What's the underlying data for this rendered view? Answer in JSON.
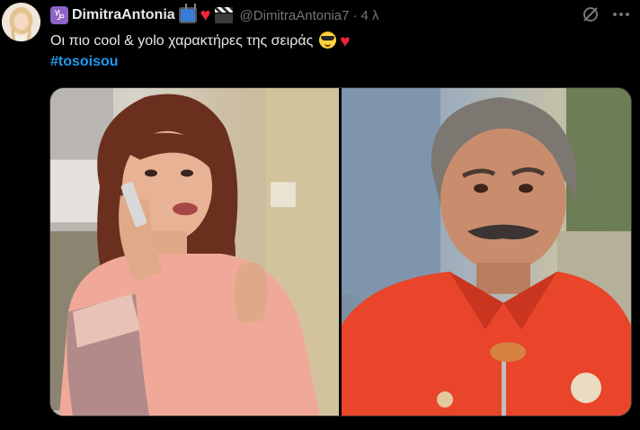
{
  "tweet": {
    "author": {
      "zodiac_symbol": "♑",
      "display_name": "DimitraAntonia",
      "handle": "@DimitraAntonia7",
      "separator": "·",
      "time": "4 λ",
      "badges": [
        "tv-icon",
        "heart-icon",
        "clapper-icon"
      ]
    },
    "text": "Οι πιο cool & yolo χαρακτήρες της σειράς",
    "text_emojis": [
      "cool-sunglasses-emoji",
      "heart-emoji"
    ],
    "heart_glyph": "♥",
    "hashtag": "#tosoisou",
    "media": {
      "count": 2,
      "left_photo": "woman-on-phone-photo",
      "right_photo": "man-in-red-shirt-photo"
    }
  },
  "colors": {
    "background": "#000000",
    "text": "#e7e9ea",
    "muted": "#71767b",
    "link": "#1d9bf0",
    "heart": "#f2233b"
  }
}
